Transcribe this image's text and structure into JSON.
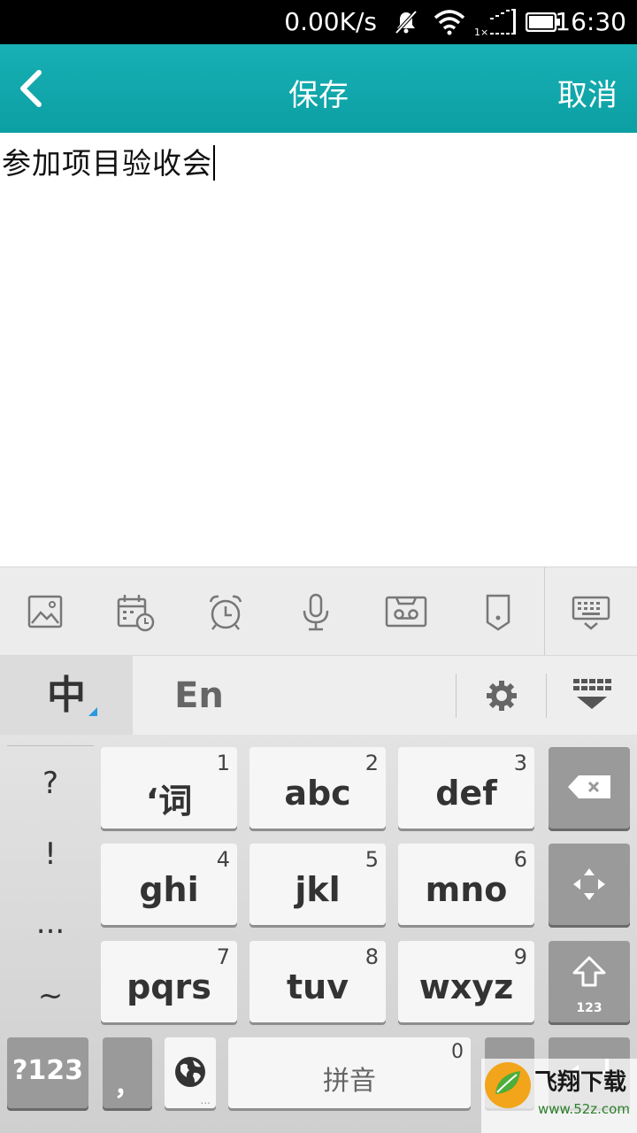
{
  "status_bar": {
    "speed": "0.00K/s",
    "network_tag": "1×",
    "time": "16:30"
  },
  "title_bar": {
    "title": "保存",
    "cancel_label": "取消",
    "background": "#12a9ad"
  },
  "editor": {
    "text": "参加项目验收会"
  },
  "toolbar": {
    "icons": [
      "image-icon",
      "calendar-icon",
      "alarm-clock-icon",
      "microphone-icon",
      "cassette-icon",
      "tag-icon",
      "keyboard-icon"
    ]
  },
  "ime": {
    "tab_zh": "中",
    "tab_en": "En",
    "accent": "#2a9ae0"
  },
  "keyboard": {
    "symbols": [
      "?",
      "!",
      "...",
      "~"
    ],
    "keys": [
      {
        "label": "‘词",
        "num": "1"
      },
      {
        "label": "abc",
        "num": "2"
      },
      {
        "label": "def",
        "num": "3"
      },
      {
        "label": "ghi",
        "num": "4"
      },
      {
        "label": "jkl",
        "num": "5"
      },
      {
        "label": "mno",
        "num": "6"
      },
      {
        "label": "pqrs",
        "num": "7"
      },
      {
        "label": "tuv",
        "num": "8"
      },
      {
        "label": "wxyz",
        "num": "9"
      }
    ],
    "shift_sub": "123",
    "num_key": "?123",
    "comma": "，",
    "globe_dots": "...",
    "space_label": "拼音",
    "space_num": "0"
  },
  "watermark": {
    "name": "飞翔下载",
    "url": "www.52z.com"
  }
}
